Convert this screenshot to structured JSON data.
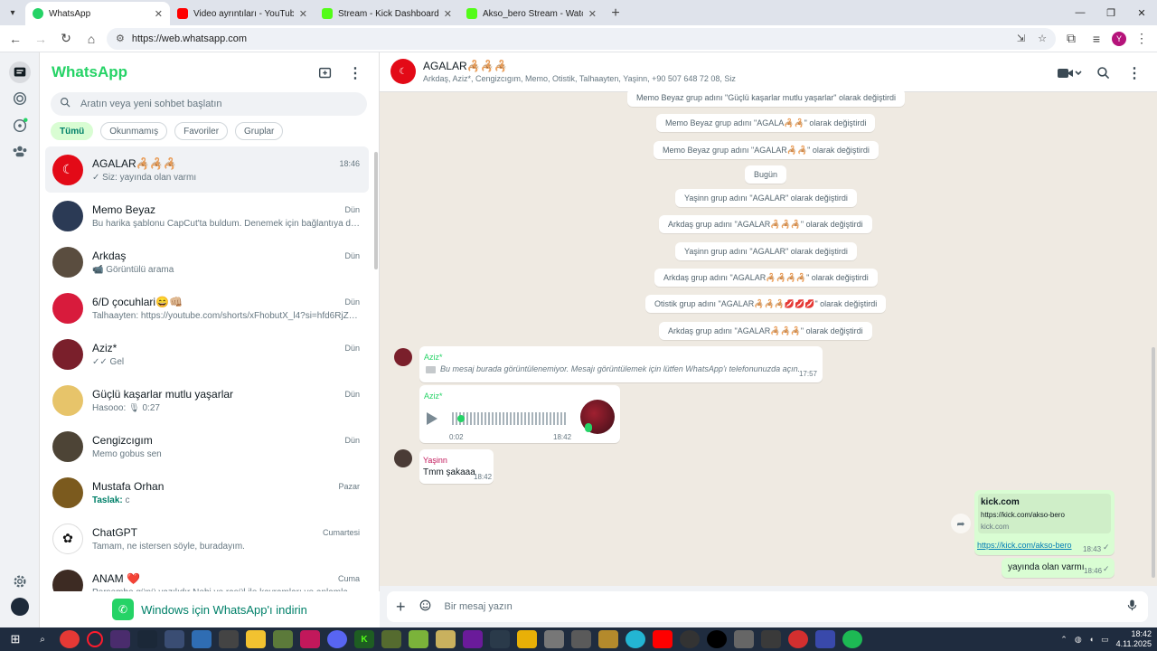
{
  "browser": {
    "tabs": [
      {
        "title": "WhatsApp",
        "color": "#25d366",
        "active": true
      },
      {
        "title": "Video ayrıntıları - YouTube Stud",
        "color": "#ff0000",
        "active": false
      },
      {
        "title": "Stream - Kick Dashboard",
        "color": "#53fc18",
        "active": false
      },
      {
        "title": "Akso_bero Stream - Watch Live",
        "color": "#53fc18",
        "active": false
      }
    ],
    "url": "https://web.whatsapp.com",
    "profile_initial": "Y"
  },
  "sidebar": {
    "brand": "WhatsApp",
    "search_placeholder": "Aratın veya yeni sohbet başlatın",
    "filters": [
      "Tümü",
      "Okunmamış",
      "Favoriler",
      "Gruplar"
    ],
    "chats": [
      {
        "name": "AGALAR🦂🦂🦂",
        "time": "18:46",
        "preview": "✓ Siz: yayında olan varmı",
        "avatar_color": "#e30a17",
        "avatar_text": "☾"
      },
      {
        "name": "Memo Beyaz",
        "time": "Dün",
        "preview": "Bu harika şablonu CapCut'ta buldum. Denemek için bağlantıya doku…",
        "avatar_color": "#2b3a55",
        "avatar_text": ""
      },
      {
        "name": "Arkdaş",
        "time": "Dün",
        "preview": "📹 Görüntülü arama",
        "avatar_color": "#5a4d3f",
        "avatar_text": ""
      },
      {
        "name": "6/D çocuhlari😄👊🏼",
        "time": "Dün",
        "preview": "Talhaayten: https://youtube.com/shorts/xFhobutX_l4?si=hfd6RjZDB3I…",
        "avatar_color": "#d81b3c",
        "avatar_text": ""
      },
      {
        "name": "Aziz*",
        "time": "Dün",
        "preview": "✓✓ Gel",
        "avatar_color": "#7a1f2b",
        "avatar_text": ""
      },
      {
        "name": "Güçlü kaşarlar mutlu yaşarlar",
        "time": "Dün",
        "preview": "Hasooo: 🎙 0:27",
        "avatar_color": "#e7c46a",
        "avatar_text": ""
      },
      {
        "name": "Cengizcıgım",
        "time": "Dün",
        "preview": "Memo gobus sen",
        "avatar_color": "#4d4436",
        "avatar_text": ""
      },
      {
        "name": "Mustafa Orhan",
        "time": "Pazar",
        "preview_draft": "Taslak:",
        "preview": " c",
        "avatar_color": "#7b5a1e",
        "avatar_text": ""
      },
      {
        "name": "ChatGPT",
        "time": "Cumartesi",
        "preview": "Tamam, ne istersen söyle, buradayım.",
        "avatar_color": "#ffffff",
        "avatar_text": "✿"
      },
      {
        "name": "ANAM ❤️",
        "time": "Cuma",
        "preview": "Perşembe günü yazılıdır Nebi ve rasül ile kavramları ve anlamları yah…",
        "avatar_color": "#3d2b23",
        "avatar_text": ""
      }
    ],
    "download_text": "Windows için WhatsApp'ı indirin"
  },
  "conversation": {
    "title": "AGALAR🦂🦂🦂",
    "subtitle": "Arkdaş, Aziz*, Cengizcıgım, Memo, Otistik, Talhaayten, Yaşinn, +90 507 648 72 08, Siz",
    "system_messages": [
      "Memo Beyaz grup adını \"Güçlü kaşarlar mutlu yaşarlar\" olarak değiştirdi",
      "Memo Beyaz grup adını \"AGALA🦂🦂\" olarak değiştirdi",
      "Memo Beyaz grup adını \"AGALAR🦂🦂\" olarak değiştirdi",
      "Bugün",
      "Yaşinn grup adını \"AGALAR\" olarak değiştirdi",
      "Arkdaş grup adını \"AGALAR🦂🦂🦂\" olarak değiştirdi",
      "Yaşinn grup adını \"AGALAR\" olarak değiştirdi",
      "Arkdaş grup adını \"AGALAR🦂🦂🦂🦂\" olarak değiştirdi",
      "Otistik grup adını \"AGALAR🦂🦂🦂💋💋💋\" olarak değiştirdi",
      "Arkdaş grup adını \"AGALAR🦂🦂🦂\" olarak değiştirdi"
    ],
    "msg_aziz_1": {
      "sender": "Aziz*",
      "text": "Bu mesaj burada görüntülenemiyor. Mesajı görüntülemek için lütfen WhatsApp'ı telefonunuzda açın.",
      "time": "17:57"
    },
    "msg_aziz_voice": {
      "sender": "Aziz*",
      "duration": "0:02",
      "time": "18:42",
      "progress": 0.05
    },
    "msg_yasinn": {
      "sender": "Yaşinn",
      "text": "Tmm şakaaa",
      "time": "18:42"
    },
    "msg_link": {
      "site": "kick.com",
      "url_short": "https://kick.com/akso-bero",
      "domain": "kick.com",
      "link": "https://kick.com/akso-bero",
      "time": "18:43",
      "tick": "✓"
    },
    "msg_out": {
      "text": "yayında olan varmı",
      "time": "18:46",
      "tick": "✓"
    },
    "composer_placeholder": "Bir mesaj yazın"
  },
  "taskbar": {
    "time": "18:42",
    "date": "4.11.2025"
  },
  "colors": {
    "accent": "#25d366",
    "accent_dark": "#008069",
    "chat_bg": "#efeae2",
    "out_bubble": "#d9fdd3"
  }
}
